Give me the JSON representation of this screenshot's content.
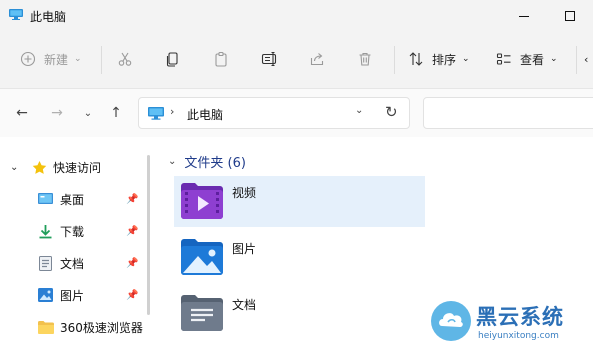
{
  "window": {
    "title": "此电脑"
  },
  "toolbar": {
    "new_label": "新建",
    "sort_label": "排序",
    "view_label": "查看"
  },
  "address": {
    "location": "此电脑"
  },
  "sidebar": {
    "items": [
      {
        "label": "快速访问",
        "icon": "star-icon",
        "color": "#f4c20d"
      },
      {
        "label": "桌面",
        "icon": "desktop-icon",
        "color": "#3a8fd6"
      },
      {
        "label": "下载",
        "icon": "download-icon",
        "color": "#1f9e5a"
      },
      {
        "label": "文档",
        "icon": "document-icon",
        "color": "#7c8796"
      },
      {
        "label": "图片",
        "icon": "pictures-icon",
        "color": "#2a7fd4"
      },
      {
        "label": "360极速浏览器",
        "icon": "folder-icon",
        "color": "#f2c14e"
      }
    ]
  },
  "content": {
    "group_title": "文件夹 (6)",
    "folders": [
      {
        "label": "视频",
        "icon": "videos-folder-icon",
        "color": "#8e3fd1"
      },
      {
        "label": "图片",
        "icon": "pictures-folder-icon",
        "color": "#1e7ad8"
      },
      {
        "label": "文档",
        "icon": "documents-folder-icon",
        "color": "#6f7b8c"
      }
    ]
  },
  "watermark": {
    "brand": "黑云系统",
    "url": "heiyunxitong.com"
  }
}
